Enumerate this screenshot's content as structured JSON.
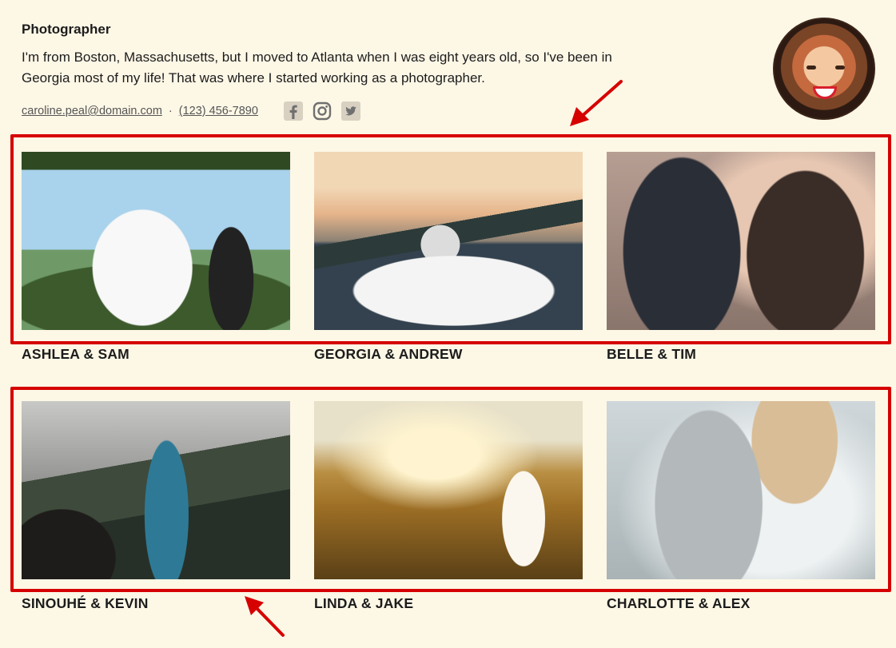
{
  "profile": {
    "role": "Photographer",
    "bio": "I'm from Boston, Massachusetts, but I moved to Atlanta when I was eight years old, so I've been in Georgia most of my life! That was where I started working as a photographer.",
    "email": "caroline.peal@domain.com",
    "separator": "·",
    "phone": "(123) 456-7890",
    "social": [
      "facebook-icon",
      "instagram-icon",
      "twitter-icon"
    ]
  },
  "gallery": [
    {
      "caption": "ASHLEA & SAM"
    },
    {
      "caption": "GEORGIA & ANDREW"
    },
    {
      "caption": "BELLE & TIM"
    },
    {
      "caption": "SINOUHÉ & KEVIN"
    },
    {
      "caption": "LINDA & JAKE"
    },
    {
      "caption": "CHARLOTTE & ALEX"
    }
  ],
  "annotation": {
    "color": "#d60000"
  }
}
